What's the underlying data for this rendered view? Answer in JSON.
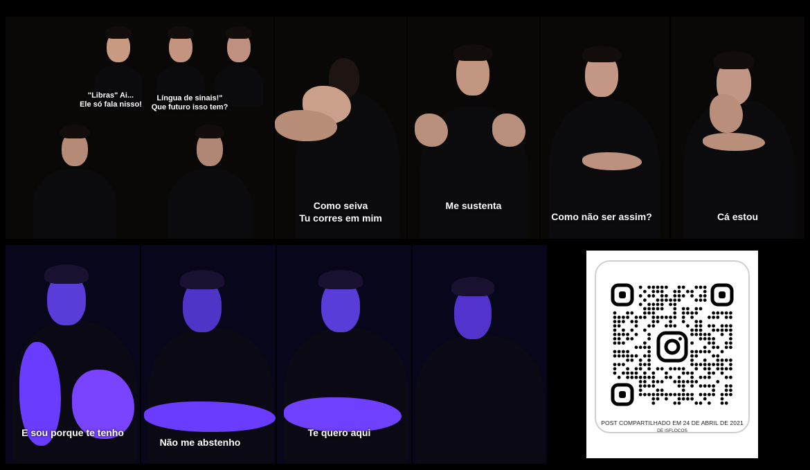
{
  "top_panels": [
    {
      "caption_a": "\"Libras\" Ai...\nEle só fala nisso!",
      "caption_b": "Língua de sinais!\"\nQue futuro isso tem?"
    },
    {
      "caption": "Como seiva\nTu corres em mim"
    },
    {
      "caption": "Me sustenta"
    },
    {
      "caption": "Como não ser assim?"
    },
    {
      "caption": "Cá estou"
    }
  ],
  "bottom_panels": [
    {
      "caption": "E sou porque te tenho"
    },
    {
      "caption": "Não me abstenho"
    },
    {
      "caption": "Te quero aqui"
    }
  ],
  "qr_card": {
    "icon": "instagram-icon",
    "footer_line1": "POST COMPARTILHADO EM 24 DE ABRIL DE 2021",
    "footer_line2": "DE ISFLOCOS"
  },
  "colors": {
    "background": "#000000",
    "uv_glow": "#6a3cff",
    "vein": "#ff5fd0"
  }
}
